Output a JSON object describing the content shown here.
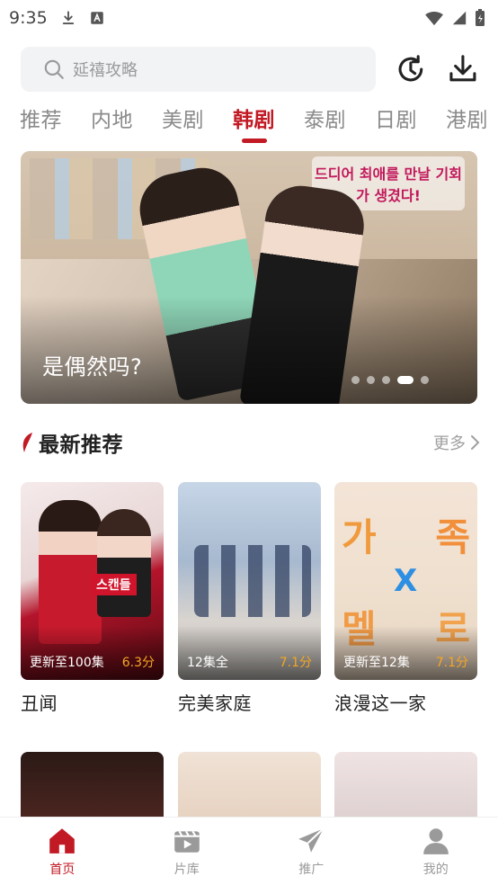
{
  "status_bar": {
    "time": "9:35"
  },
  "search": {
    "placeholder": "延禧攻略"
  },
  "tabs": [
    {
      "label": "推荐",
      "active": false
    },
    {
      "label": "内地",
      "active": false
    },
    {
      "label": "美剧",
      "active": false
    },
    {
      "label": "韩剧",
      "active": true
    },
    {
      "label": "泰剧",
      "active": false
    },
    {
      "label": "日剧",
      "active": false
    },
    {
      "label": "港剧",
      "active": false
    }
  ],
  "banner": {
    "title": "是偶然吗?",
    "overlay_text": "드디어 최애를 만날 기회가 생겼다!",
    "dots": 5,
    "active_dot": 4
  },
  "section": {
    "title": "最新推荐",
    "more": "更多"
  },
  "cards": [
    {
      "title": "丑闻",
      "status": "更新至100集",
      "score": "6.3分",
      "tag": "스캔들"
    },
    {
      "title": "完美家庭",
      "status": "12集全",
      "score": "7.1分"
    },
    {
      "title": "浪漫这一家",
      "status": "更新至12集",
      "score": "7.1分"
    }
  ],
  "bottom_nav": [
    {
      "label": "首页",
      "icon": "home-icon",
      "active": true
    },
    {
      "label": "片库",
      "icon": "film-icon",
      "active": false
    },
    {
      "label": "推广",
      "icon": "paper-plane-icon",
      "active": false
    },
    {
      "label": "我的",
      "icon": "user-icon",
      "active": false
    }
  ],
  "colors": {
    "accent": "#c21a24",
    "score": "#f5a623",
    "muted": "#9a9a9a"
  }
}
